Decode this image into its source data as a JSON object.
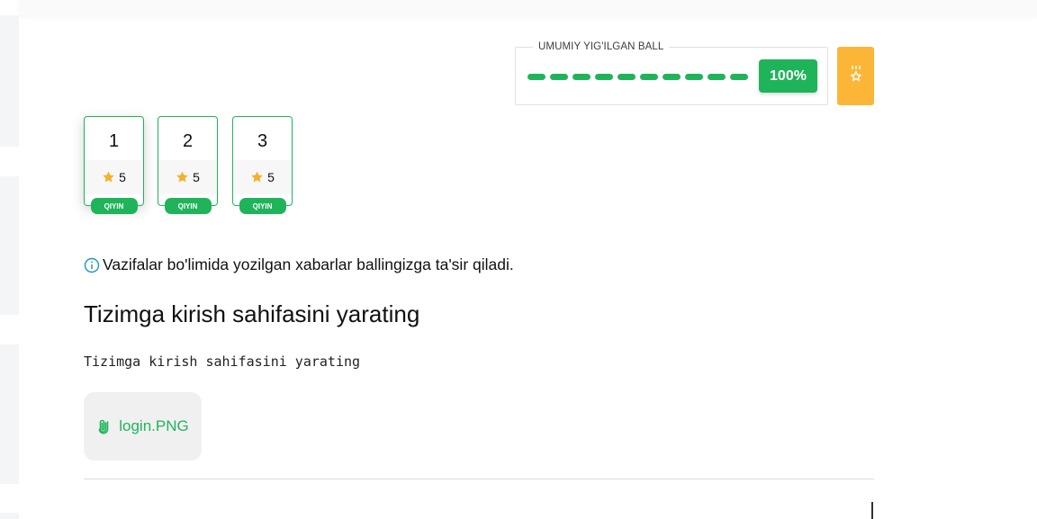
{
  "score": {
    "legend": "UMUMIY YIG'ILGAN BALL",
    "percent": "100%",
    "progress_fraction": 1.0,
    "accent_color": "#1fb45a",
    "medal_icon": "medal-star-icon",
    "medal_color": "#fbb637"
  },
  "tasks": [
    {
      "number": "1",
      "stars": "5",
      "level": "QIYIN",
      "active": true
    },
    {
      "number": "2",
      "stars": "5",
      "level": "QIYIN",
      "active": false
    },
    {
      "number": "3",
      "stars": "5",
      "level": "QIYIN",
      "active": false
    }
  ],
  "info": {
    "icon": "info-circle-icon",
    "text": "Vazifalar bo'limida yozilgan xabarlar ballingizga ta'sir qiladi."
  },
  "task": {
    "title": "Tizimga kirish sahifasini yarating",
    "description": "Tizimga kirish sahifasini yarating"
  },
  "attachment": {
    "icon": "paperclip-icon",
    "filename": "login.PNG"
  }
}
